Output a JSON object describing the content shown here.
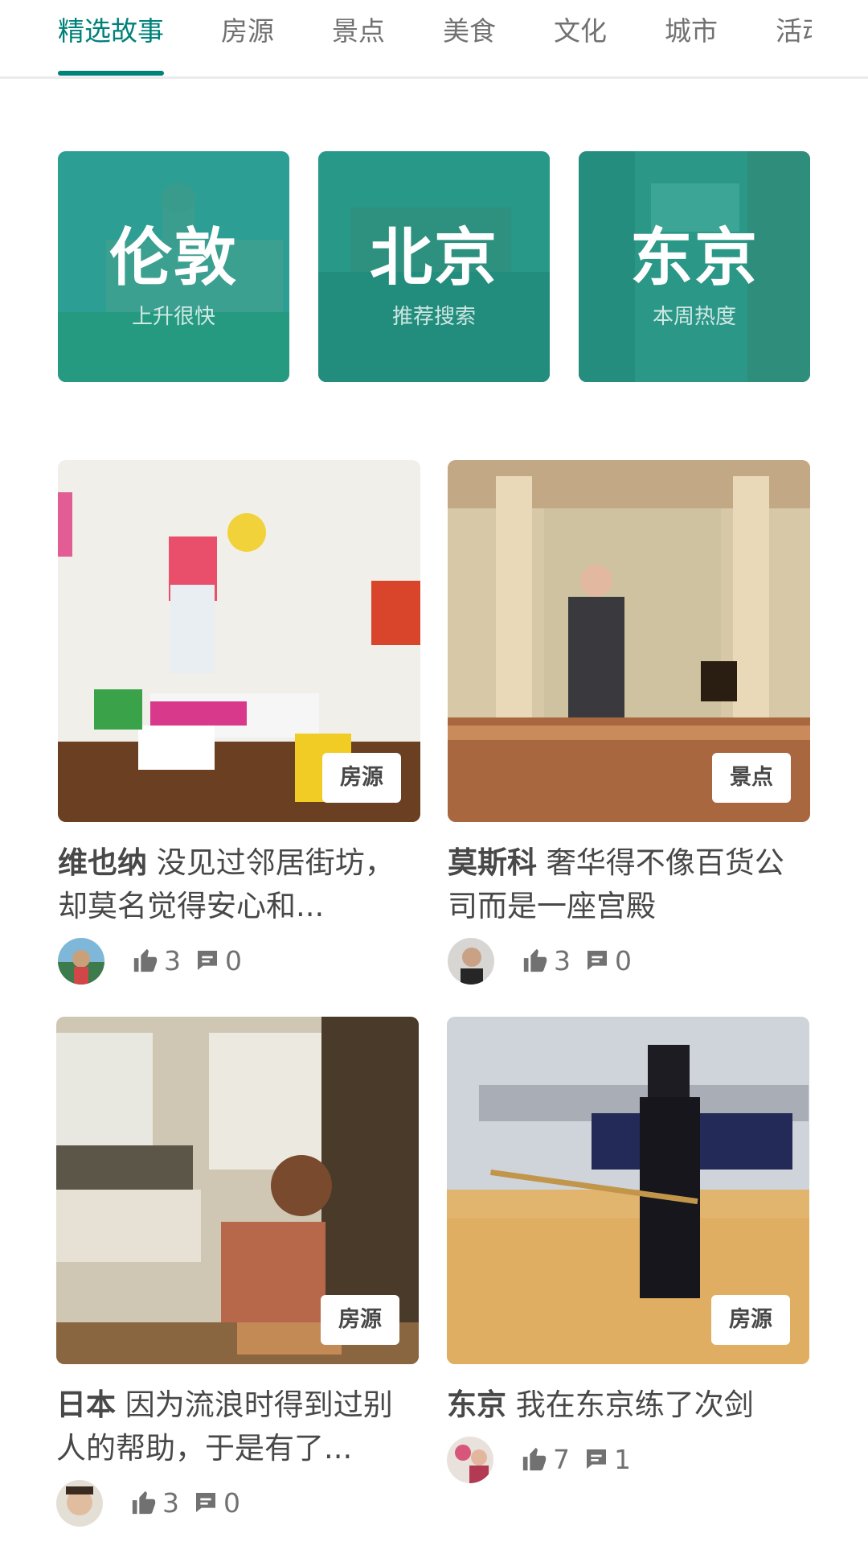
{
  "tabs": [
    {
      "label": "精选故事",
      "active": true
    },
    {
      "label": "房源",
      "active": false
    },
    {
      "label": "景点",
      "active": false
    },
    {
      "label": "美食",
      "active": false
    },
    {
      "label": "文化",
      "active": false
    },
    {
      "label": "城市",
      "active": false
    },
    {
      "label": "活动",
      "active": false
    }
  ],
  "cities": [
    {
      "name": "伦敦",
      "subtitle": "上升很快"
    },
    {
      "name": "北京",
      "subtitle": "推荐搜索"
    },
    {
      "name": "东京",
      "subtitle": "本周热度"
    }
  ],
  "stories": [
    {
      "place": "维也纳",
      "text": "没见过邻居街坊，却莫名觉得安心和...",
      "tag": "房源",
      "likes": "3",
      "comments": "0"
    },
    {
      "place": "莫斯科",
      "text": "奢华得不像百货公司而是一座宫殿",
      "tag": "景点",
      "likes": "3",
      "comments": "0"
    },
    {
      "place": "日本",
      "text": "因为流浪时得到过别人的帮助，于是有了...",
      "tag": "房源",
      "likes": "3",
      "comments": "0"
    },
    {
      "place": "东京",
      "text": "我在东京练了次剑",
      "tag": "房源",
      "likes": "7",
      "comments": "1"
    }
  ],
  "icons": {
    "like": "thumbs-up-icon",
    "comment": "comment-icon"
  },
  "colors": {
    "accent": "#00817a",
    "card_tint": "#14968a",
    "text": "#484848",
    "muted": "#717171"
  }
}
